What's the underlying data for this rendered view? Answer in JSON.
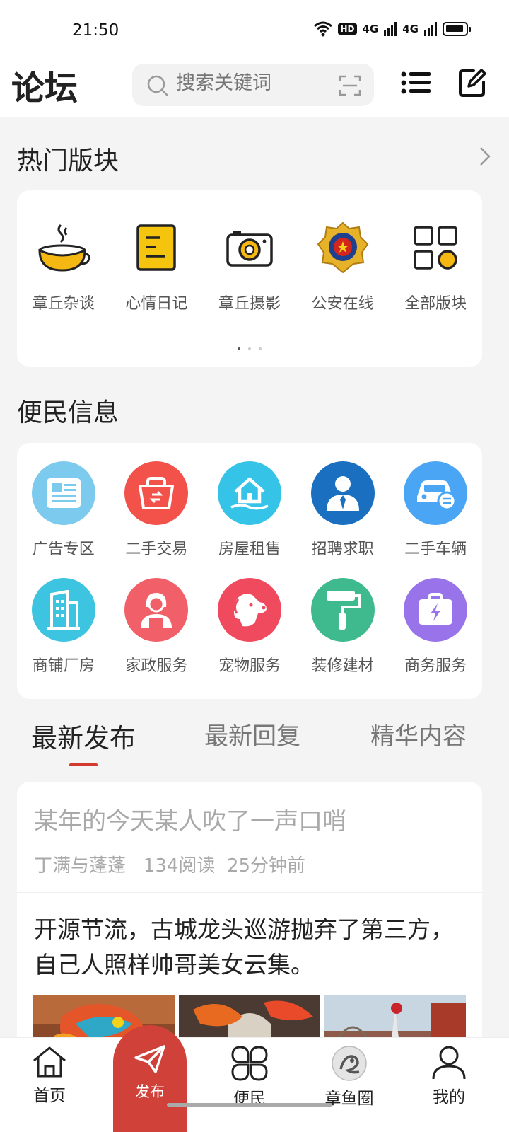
{
  "status": {
    "time": "21:50",
    "hd": "HD",
    "signal1": "4G",
    "signal2": "4G"
  },
  "header": {
    "title": "论坛",
    "search_placeholder": "搜索关键词"
  },
  "hot": {
    "title": "热门版块",
    "items": [
      {
        "label": "章丘杂谈",
        "icon": "coffee-cup-icon"
      },
      {
        "label": "心情日记",
        "icon": "notebook-icon"
      },
      {
        "label": "章丘摄影",
        "icon": "camera-icon"
      },
      {
        "label": "公安在线",
        "icon": "police-badge-icon"
      },
      {
        "label": "全部版块",
        "icon": "grid-icon"
      }
    ]
  },
  "services": {
    "title": "便民信息",
    "items": [
      {
        "label": "广告专区",
        "icon": "newspaper-icon",
        "color": "#7ccbef"
      },
      {
        "label": "二手交易",
        "icon": "basket-icon",
        "color": "#f2524a"
      },
      {
        "label": "房屋租售",
        "icon": "house-icon",
        "color": "#35c4e8"
      },
      {
        "label": "招聘求职",
        "icon": "person-icon",
        "color": "#1a6fc0"
      },
      {
        "label": "二手车辆",
        "icon": "car-icon",
        "color": "#4aa6f5"
      },
      {
        "label": "商铺厂房",
        "icon": "building-icon",
        "color": "#3cc4e0"
      },
      {
        "label": "家政服务",
        "icon": "housekeeper-icon",
        "color": "#f16068"
      },
      {
        "label": "宠物服务",
        "icon": "dog-icon",
        "color": "#f04a5e"
      },
      {
        "label": "装修建材",
        "icon": "paint-roller-icon",
        "color": "#3fba8f"
      },
      {
        "label": "商务服务",
        "icon": "briefcase-icon",
        "color": "#9873ea"
      }
    ]
  },
  "tabs": [
    "最新发布",
    "最新回复",
    "精华内容"
  ],
  "posts": [
    {
      "title": "某年的今天某人吹了一声口哨",
      "meta": "丁满与蓬蓬   134阅读  25分钟前"
    },
    {
      "title": "开源节流，古城龙头巡游抛弃了第三方，自己人照样帅哥美女云集。"
    }
  ],
  "nav": {
    "home": "首页",
    "publish": "发布",
    "services": "便民",
    "circle": "章鱼圈",
    "mine": "我的"
  }
}
